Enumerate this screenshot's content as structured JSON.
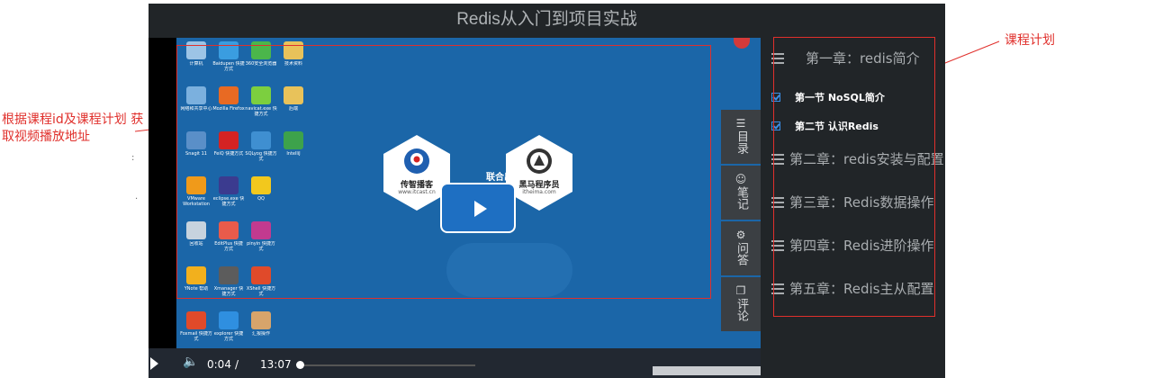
{
  "annotations": {
    "left_note": "根据课程id及课程计划 获取视频播放地址",
    "right_note": "课程计划"
  },
  "player": {
    "title": "Redis从入门到项目实战",
    "video": {
      "brand_left": "传智播客",
      "brand_left_url": "www.itcast.cn",
      "joint_label": "联合出品",
      "brand_right": "黑马程序员",
      "brand_right_url": "itheima.com"
    },
    "controls": {
      "current_time": "0:04",
      "separator": "/",
      "duration": "13:07"
    },
    "side_tabs": [
      {
        "label": "目录",
        "icon": "list-icon"
      },
      {
        "label": "笔记",
        "icon": "person-icon"
      },
      {
        "label": "问答",
        "icon": "gear-icon"
      },
      {
        "label": "评论",
        "icon": "copy-icon"
      }
    ],
    "desktop_icons": [
      {
        "label": "计算机",
        "color": "#9cc4e6"
      },
      {
        "label": "Baidupen 快捷方式",
        "color": "#3a9de0"
      },
      {
        "label": "360安全浏览器",
        "color": "#4bb64b"
      },
      {
        "label": "技术资料",
        "color": "#e8c25a"
      },
      {
        "label": "网络和共享中心",
        "color": "#7bb0de"
      },
      {
        "label": "Mozilla Firefox",
        "color": "#e86a23"
      },
      {
        "label": "navicat.exe 快捷方式",
        "color": "#7ccf3f"
      },
      {
        "label": "后端",
        "color": "#e8c25a"
      },
      {
        "label": "Snagit 11",
        "color": "#5a8fc8"
      },
      {
        "label": "FeiQ 快捷方式",
        "color": "#d42323"
      },
      {
        "label": "SQLyog 快捷方式",
        "color": "#3f8fd1"
      },
      {
        "label": "IntelliJ",
        "color": "#3da24b"
      },
      {
        "label": "VMware Workstation",
        "color": "#f09a1a"
      },
      {
        "label": "eclipse.exe 快捷方式",
        "color": "#3b3b8f"
      },
      {
        "label": "QQ",
        "color": "#f2c81d"
      },
      {
        "label": "回收站",
        "color": "#c7d3de"
      },
      {
        "label": "EditPlus 快捷方式",
        "color": "#e85b4b"
      },
      {
        "label": "pinyin 快捷方式",
        "color": "#c23a8f"
      },
      {
        "label": "YNote 帮助",
        "color": "#f2b01d"
      },
      {
        "label": "Xmanager 快捷方式",
        "color": "#5c5c5c"
      },
      {
        "label": "XShell 快捷方式",
        "color": "#e04a2a"
      },
      {
        "label": "Foxmail 快捷方式",
        "color": "#e04a2a"
      },
      {
        "label": "explorer 快捷方式",
        "color": "#2f8fe0"
      },
      {
        "label": "汇报操作",
        "color": "#d7a46b"
      }
    ]
  },
  "plan": {
    "chapters": [
      {
        "title": "第一章：redis简介"
      },
      {
        "title": "第二章：redis安装与配置"
      },
      {
        "title": "第三章：Redis数据操作"
      },
      {
        "title": "第四章：Redis进阶操作"
      },
      {
        "title": "第五章：Redis主从配置"
      }
    ],
    "sections": [
      {
        "title": "第一节 NoSQL简介"
      },
      {
        "title": "第二节 认识Redis"
      }
    ]
  },
  "colors": {
    "player_bg": "#212528",
    "desktop_blue": "#1b66a8",
    "annotation_red": "#e0302c",
    "check_blue": "#3a8ee6"
  }
}
